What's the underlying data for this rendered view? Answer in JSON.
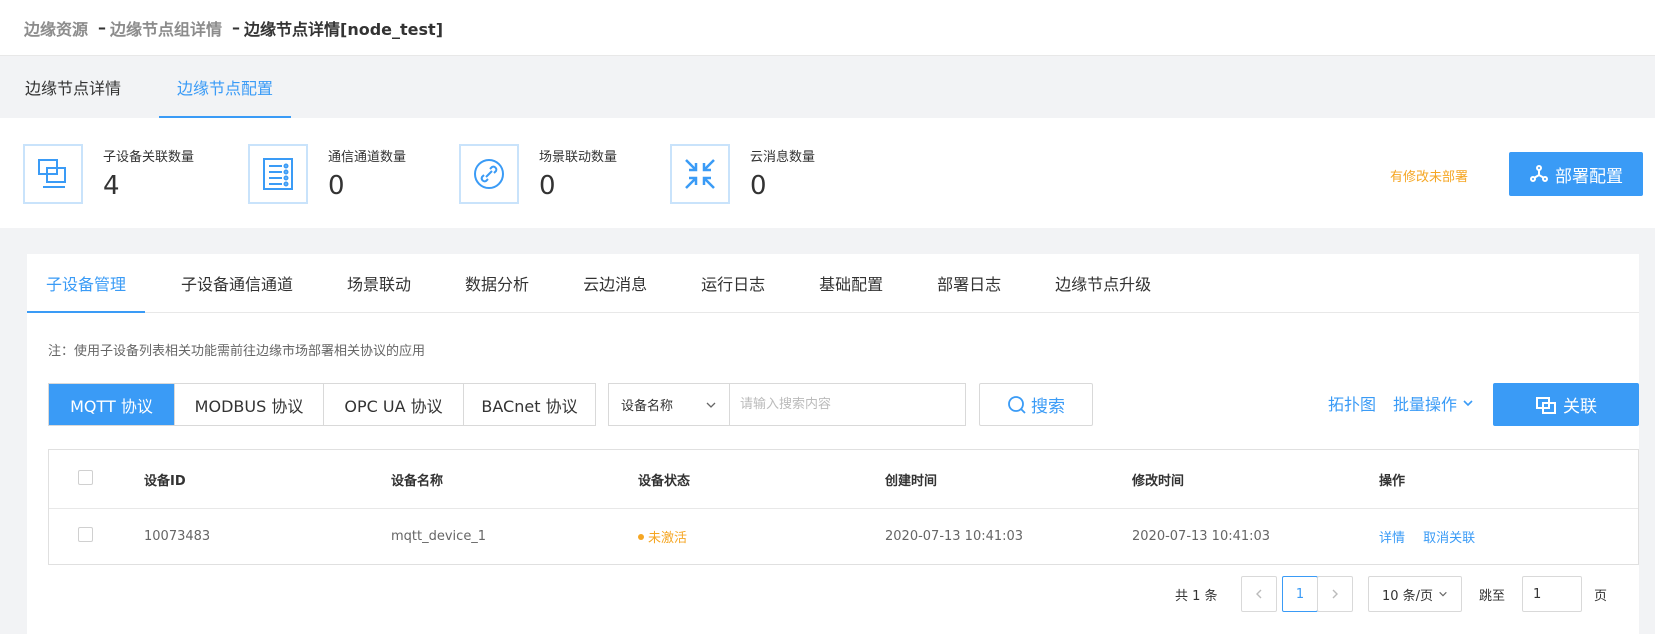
{
  "breadcrumb": {
    "items": [
      "边缘资源",
      "边缘节点组详情",
      "边缘节点详情[node_test]"
    ],
    "separator": "–"
  },
  "top_tabs": [
    {
      "label": "边缘节点详情",
      "active": false
    },
    {
      "label": "边缘节点配置",
      "active": true
    }
  ],
  "stats": [
    {
      "label": "子设备关联数量",
      "value": "4",
      "icon": "device-copy-icon"
    },
    {
      "label": "通信通道数量",
      "value": "0",
      "icon": "channel-list-icon"
    },
    {
      "label": "场景联动数量",
      "value": "0",
      "icon": "link-icon"
    },
    {
      "label": "云消息数量",
      "value": "0",
      "icon": "collapse-arrows-icon"
    }
  ],
  "deploy": {
    "pending_text": "有修改未部署",
    "button_label": "部署配置"
  },
  "sub_tabs": [
    {
      "label": "子设备管理",
      "active": true
    },
    {
      "label": "子设备通信通道",
      "active": false
    },
    {
      "label": "场景联动",
      "active": false
    },
    {
      "label": "数据分析",
      "active": false
    },
    {
      "label": "云边消息",
      "active": false
    },
    {
      "label": "运行日志",
      "active": false
    },
    {
      "label": "基础配置",
      "active": false
    },
    {
      "label": "部署日志",
      "active": false
    },
    {
      "label": "边缘节点升级",
      "active": false
    }
  ],
  "note": "注：使用子设备列表相关功能需前往边缘市场部署相关协议的应用",
  "protocols": [
    {
      "label": "MQTT 协议",
      "active": true
    },
    {
      "label": "MODBUS 协议",
      "active": false
    },
    {
      "label": "OPC UA 协议",
      "active": false
    },
    {
      "label": "BACnet 协议",
      "active": false
    }
  ],
  "search": {
    "field_selected": "设备名称",
    "placeholder": "请输入搜索内容",
    "value": "",
    "button_label": "搜索"
  },
  "actions": {
    "topology": "拓扑图",
    "batch": "批量操作",
    "associate": "关联"
  },
  "table": {
    "columns": [
      "设备ID",
      "设备名称",
      "设备状态",
      "创建时间",
      "修改时间",
      "操作"
    ],
    "rows": [
      {
        "id": "10073483",
        "name": "mqtt_device_1",
        "status": "未激活",
        "created": "2020-07-13 10:41:03",
        "modified": "2020-07-13 10:41:03",
        "ops": [
          "详情",
          "取消关联"
        ]
      }
    ]
  },
  "pagination": {
    "total_text": "共 1 条",
    "current_page": "1",
    "page_size": "10 条/页",
    "jump_label": "跳至",
    "jump_value": "1",
    "page_label": "页"
  },
  "colors": {
    "primary": "#3a9bf6",
    "warning": "#f5a623",
    "icon_border": "#c9e3fb"
  }
}
